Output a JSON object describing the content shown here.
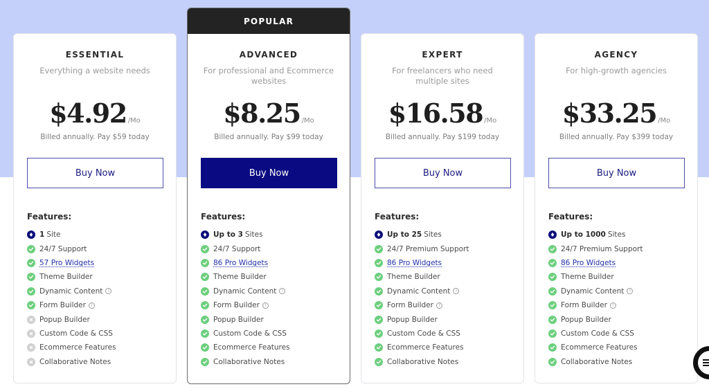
{
  "colors": {
    "hero_background": "#c5d0fa",
    "accent": "#0a0a82",
    "check_green": "#6dcf7e",
    "cross_gray": "#d0d0d0",
    "popular_band": "#222322"
  },
  "plans": [
    {
      "name": "ESSENTIAL",
      "description": "Everything a website needs",
      "price": "$4.92",
      "period": "/Mo",
      "billing": "Billed annually. Pay $59 today",
      "button": "Buy Now",
      "popular": false,
      "features_title": "Features:",
      "features": [
        {
          "icon": "sites-icon",
          "bold": "1",
          "text": "Site",
          "status": "sites"
        },
        {
          "icon": "check-icon",
          "text": "24/7 Support",
          "status": "included"
        },
        {
          "icon": "check-icon",
          "text": "57 Pro Widgets",
          "status": "included",
          "link": true
        },
        {
          "icon": "check-icon",
          "text": "Theme Builder",
          "status": "included"
        },
        {
          "icon": "check-icon",
          "text": "Dynamic Content",
          "status": "included",
          "info": true
        },
        {
          "icon": "check-icon",
          "text": "Form Builder",
          "status": "included",
          "info": true
        },
        {
          "icon": "cross-icon",
          "text": "Popup Builder",
          "status": "excluded"
        },
        {
          "icon": "cross-icon",
          "text": "Custom Code & CSS",
          "status": "excluded"
        },
        {
          "icon": "cross-icon",
          "text": "Ecommerce Features",
          "status": "excluded"
        },
        {
          "icon": "cross-icon",
          "text": "Collaborative Notes",
          "status": "excluded"
        }
      ]
    },
    {
      "name": "ADVANCED",
      "badge": "POPULAR",
      "description": "For professional and Ecommerce websites",
      "price": "$8.25",
      "period": "/Mo",
      "billing": "Billed annually. Pay $99 today",
      "button": "Buy Now",
      "popular": true,
      "features_title": "Features:",
      "features": [
        {
          "icon": "sites-icon",
          "bold": "Up to 3",
          "text": "Sites",
          "status": "sites"
        },
        {
          "icon": "check-icon",
          "text": "24/7 Support",
          "status": "included"
        },
        {
          "icon": "check-icon",
          "text": "86 Pro Widgets",
          "status": "included",
          "link": true
        },
        {
          "icon": "check-icon",
          "text": "Theme Builder",
          "status": "included"
        },
        {
          "icon": "check-icon",
          "text": "Dynamic Content",
          "status": "included",
          "info": true
        },
        {
          "icon": "check-icon",
          "text": "Form Builder",
          "status": "included",
          "info": true
        },
        {
          "icon": "check-icon",
          "text": "Popup Builder",
          "status": "included"
        },
        {
          "icon": "check-icon",
          "text": "Custom Code & CSS",
          "status": "included"
        },
        {
          "icon": "check-icon",
          "text": "Ecommerce Features",
          "status": "included"
        },
        {
          "icon": "check-icon",
          "text": "Collaborative Notes",
          "status": "included"
        }
      ]
    },
    {
      "name": "EXPERT",
      "description": "For freelancers who need multiple sites",
      "price": "$16.58",
      "period": "/Mo",
      "billing": "Billed annually. Pay $199 today",
      "button": "Buy Now",
      "popular": false,
      "features_title": "Features:",
      "features": [
        {
          "icon": "sites-icon",
          "bold": "Up to 25",
          "text": "Sites",
          "status": "sites"
        },
        {
          "icon": "check-icon",
          "text": "24/7 Premium Support",
          "status": "included"
        },
        {
          "icon": "check-icon",
          "text": "86 Pro Widgets",
          "status": "included",
          "link": true
        },
        {
          "icon": "check-icon",
          "text": "Theme Builder",
          "status": "included"
        },
        {
          "icon": "check-icon",
          "text": "Dynamic Content",
          "status": "included",
          "info": true
        },
        {
          "icon": "check-icon",
          "text": "Form Builder",
          "status": "included",
          "info": true
        },
        {
          "icon": "check-icon",
          "text": "Popup Builder",
          "status": "included"
        },
        {
          "icon": "check-icon",
          "text": "Custom Code & CSS",
          "status": "included"
        },
        {
          "icon": "check-icon",
          "text": "Ecommerce Features",
          "status": "included"
        },
        {
          "icon": "check-icon",
          "text": "Collaborative Notes",
          "status": "included"
        }
      ]
    },
    {
      "name": "AGENCY",
      "description": "For high-growth agencies",
      "price": "$33.25",
      "period": "/Mo",
      "billing": "Billed annually. Pay $399 today",
      "button": "Buy Now",
      "popular": false,
      "features_title": "Features:",
      "features": [
        {
          "icon": "sites-icon",
          "bold": "Up to 1000",
          "text": "Sites",
          "status": "sites"
        },
        {
          "icon": "check-icon",
          "text": "24/7 Premium Support",
          "status": "included"
        },
        {
          "icon": "check-icon",
          "text": "86 Pro Widgets",
          "status": "included",
          "link": true
        },
        {
          "icon": "check-icon",
          "text": "Theme Builder",
          "status": "included"
        },
        {
          "icon": "check-icon",
          "text": "Dynamic Content",
          "status": "included",
          "info": true
        },
        {
          "icon": "check-icon",
          "text": "Form Builder",
          "status": "included",
          "info": true
        },
        {
          "icon": "check-icon",
          "text": "Popup Builder",
          "status": "included"
        },
        {
          "icon": "check-icon",
          "text": "Custom Code & CSS",
          "status": "included"
        },
        {
          "icon": "check-icon",
          "text": "Ecommerce Features",
          "status": "included"
        },
        {
          "icon": "check-icon",
          "text": "Collaborative Notes",
          "status": "included"
        }
      ]
    }
  ],
  "info_glyph": "!",
  "chat_widget": {
    "icon": "chat-icon"
  }
}
